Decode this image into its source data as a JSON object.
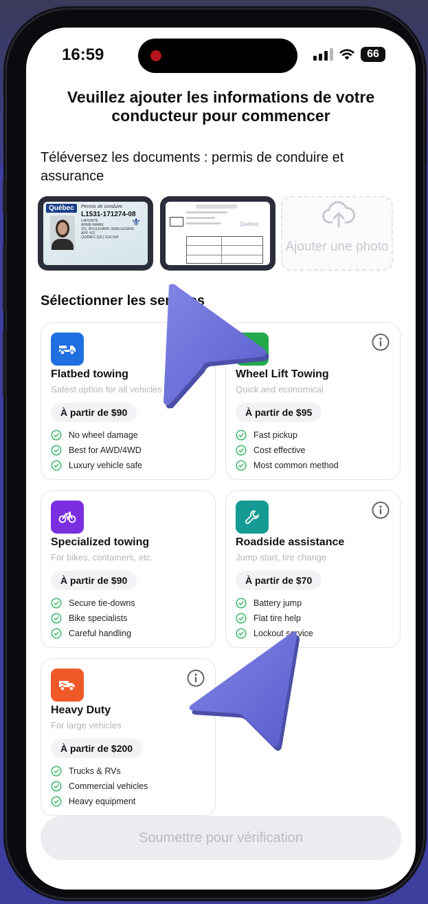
{
  "status": {
    "time": "16:59",
    "battery": "66"
  },
  "title": "Veuillez ajouter les informations de votre conducteur pour commencer",
  "upload_label": "Téléversez les documents : permis de conduire et assurance",
  "add_photo_label": "Ajouter une photo",
  "license_thumb": {
    "header": "Québec",
    "doc_title": "Permis de conduire",
    "number": "L1531-171274-08",
    "name_line1": "LAPOINTE",
    "name_line2": "ANNIE-MARIE",
    "address1": "321, BOULEVARD JEAN-LESAGE",
    "address2": "APP. 422",
    "address3": "QUÉBEC (QC) G1K 8J8"
  },
  "insurance_thumb": {
    "header": "Québec"
  },
  "services_title": "Sélectionner les services",
  "services": [
    {
      "title": "Flatbed towing",
      "subtitle": "Safest option for all vehicles",
      "price": "À partir de $90",
      "icon": "flatbed-truck-icon",
      "color": "#1f6fe0",
      "features": [
        "No wheel damage",
        "Best for AWD/4WD",
        "Luxury vehicle safe"
      ]
    },
    {
      "title": "Wheel Lift Towing",
      "subtitle": "Quick and economical",
      "price": "À partir de $95",
      "icon": "wheel-lift-icon",
      "color": "#22a94a",
      "features": [
        "Fast pickup",
        "Cost effective",
        "Most common method"
      ]
    },
    {
      "title": "Specialized towing",
      "subtitle": "For bikes, containers, etc.",
      "price": "À partir de $90",
      "icon": "bike-icon",
      "color": "#7a2ee0",
      "features": [
        "Secure tie-downs",
        "Bike specialists",
        "Careful handling"
      ]
    },
    {
      "title": "Roadside assistance",
      "subtitle": "Jump start, tire change",
      "price": "À partir de $70",
      "icon": "wrench-icon",
      "color": "#159a94",
      "features": [
        "Battery jump",
        "Flat tire help",
        "Lockout service"
      ]
    },
    {
      "title": "Heavy Duty",
      "subtitle": "For large vehicles",
      "price": "À partir de $200",
      "icon": "heavy-truck-icon",
      "color": "#f05a28",
      "features": [
        "Trucks & RVs",
        "Commercial vehicles",
        "Heavy equipment"
      ]
    }
  ],
  "submit_label": "Soumettre pour vérification",
  "colors": {
    "check": "#3ab86a",
    "accent_cursor": "#6b6fd6"
  }
}
